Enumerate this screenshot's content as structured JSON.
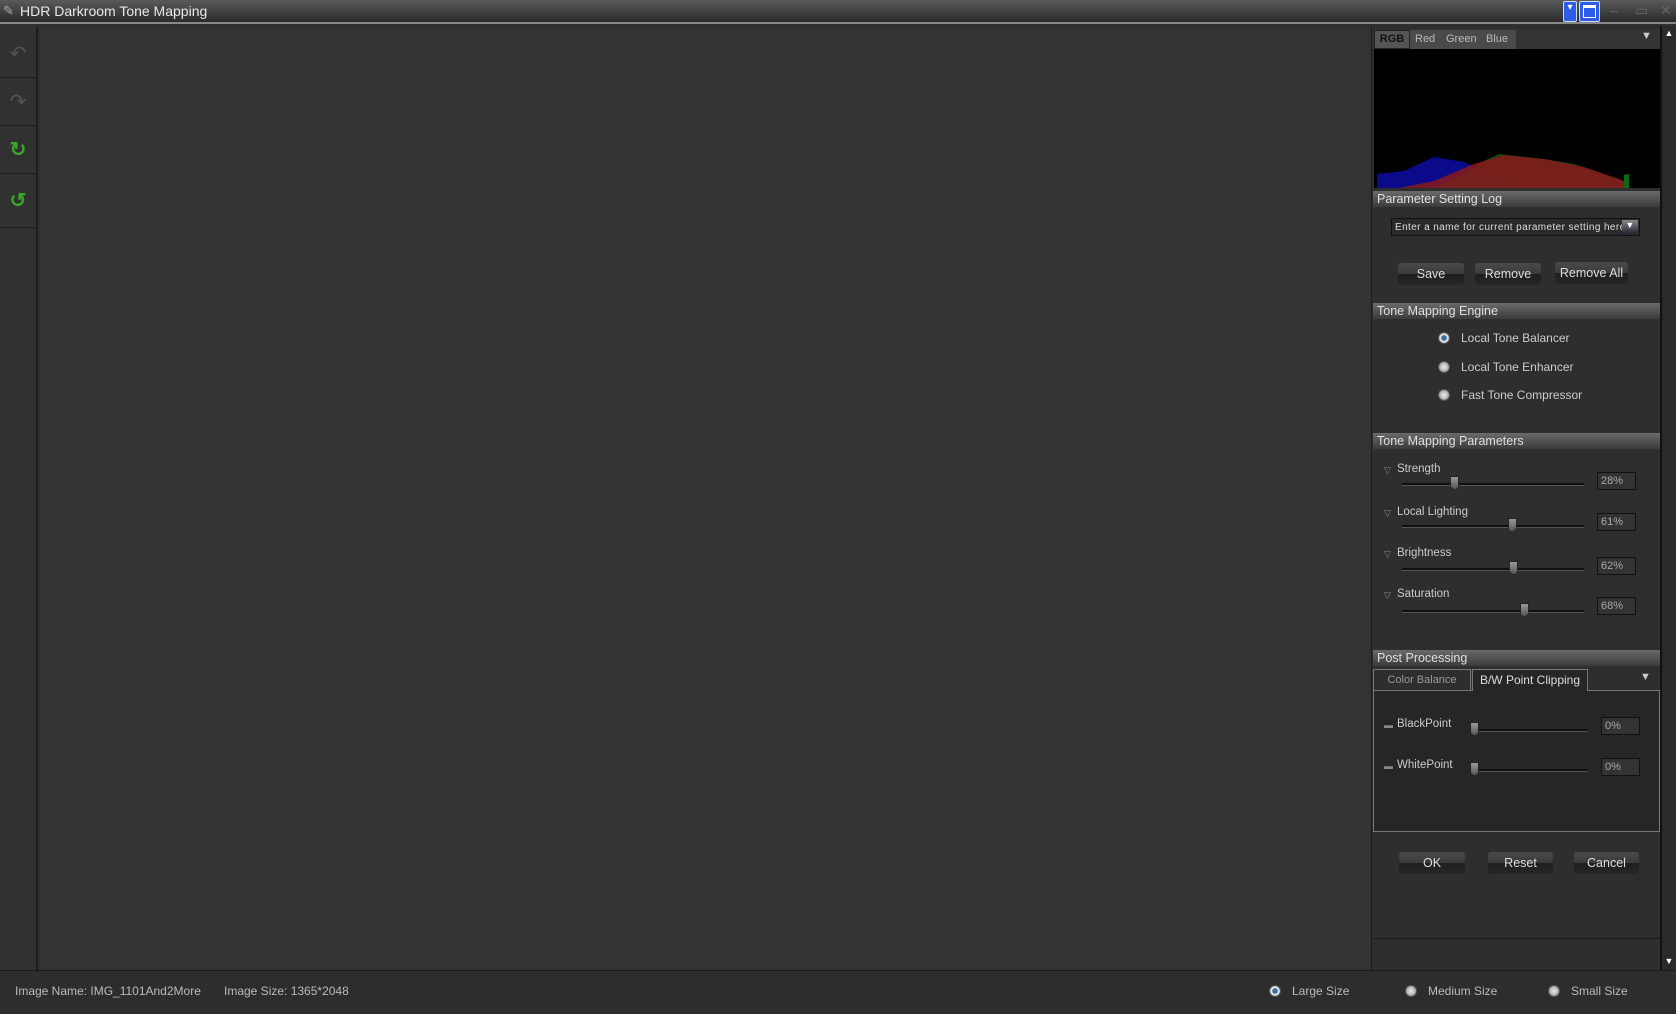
{
  "window": {
    "title": "HDR Darkroom Tone Mapping"
  },
  "toolbar": {
    "icons": [
      "undo-icon",
      "redo-icon",
      "rotate-clockwise-icon",
      "rotate-counterclockwise-icon"
    ]
  },
  "histogram": {
    "tabs": [
      "RGB",
      "Red",
      "Green",
      "Blue"
    ],
    "active_tab": "RGB"
  },
  "param_log": {
    "title": "Parameter Setting Log",
    "placeholder": "Enter a name for current parameter setting here",
    "save": "Save",
    "remove": "Remove",
    "remove_all": "Remove All"
  },
  "engine": {
    "title": "Tone Mapping Engine",
    "options": [
      "Local Tone Balancer",
      "Local Tone Enhancer",
      "Fast Tone Compressor"
    ],
    "selected": "Local Tone Balancer"
  },
  "params": {
    "title": "Tone Mapping Parameters",
    "items": [
      {
        "label": "Strength",
        "value": "28%",
        "pct": 28
      },
      {
        "label": "Local Lighting",
        "value": "61%",
        "pct": 61
      },
      {
        "label": "Brightness",
        "value": "62%",
        "pct": 62
      },
      {
        "label": "Saturation",
        "value": "68%",
        "pct": 68
      }
    ]
  },
  "post": {
    "title": "Post Processing",
    "tabs": [
      "Color Balance",
      "B/W Point Clipping"
    ],
    "active_tab": "B/W Point Clipping",
    "items": [
      {
        "label": "BlackPoint",
        "value": "0%",
        "pct": 0
      },
      {
        "label": "WhitePoint",
        "value": "0%",
        "pct": 0
      }
    ]
  },
  "actions": {
    "ok": "OK",
    "reset": "Reset",
    "cancel": "Cancel"
  },
  "status": {
    "image_name": "Image Name: IMG_1101And2More",
    "image_size": "Image Size: 1365*2048",
    "sizes": [
      "Large Size",
      "Medium Size",
      "Small Size"
    ],
    "selected_size": "Large Size"
  },
  "colors": {
    "accent": "#2d5ce8",
    "radio_selected": "#3a6ea5",
    "green_icon": "#3aa52a"
  }
}
